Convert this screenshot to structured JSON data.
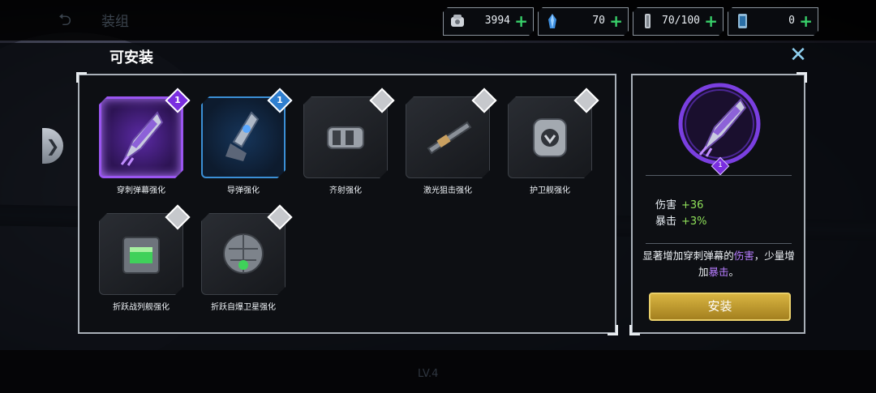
{
  "topbar": {
    "back_glyph": "⮌",
    "title": "装组",
    "resources": [
      {
        "icon": "silver-coin-icon",
        "value": "3994",
        "plus": "+"
      },
      {
        "icon": "blue-crystal-icon",
        "value": "70",
        "plus": "+"
      },
      {
        "icon": "metal-part-icon",
        "value": "70/100",
        "plus": "+"
      },
      {
        "icon": "energy-tank-icon",
        "value": "0",
        "plus": "+"
      }
    ]
  },
  "panel": {
    "title": "可安装",
    "close_glyph": "✕",
    "side_arrow_glyph": "❯"
  },
  "items": [
    {
      "name": "穿刺弹幕强化",
      "count": "1",
      "rarity": "purple",
      "selected": true
    },
    {
      "name": "导弹强化",
      "count": "1",
      "rarity": "blue",
      "selected": false
    },
    {
      "name": "齐射强化",
      "count": "",
      "rarity": "grey",
      "selected": false
    },
    {
      "name": "激光狙击强化",
      "count": "",
      "rarity": "grey",
      "selected": false
    },
    {
      "name": "护卫舰强化",
      "count": "",
      "rarity": "grey",
      "selected": false
    },
    {
      "name": "折跃战列舰强化",
      "count": "",
      "rarity": "grey",
      "selected": false
    },
    {
      "name": "折跃自爆卫星强化",
      "count": "",
      "rarity": "grey",
      "selected": false
    }
  ],
  "detail": {
    "badge": "1",
    "stats": [
      {
        "label": "伤害",
        "value": "+36"
      },
      {
        "label": "暴击",
        "value": "+3%"
      }
    ],
    "desc_part1": "显著增加穿刺弹幕的",
    "desc_hl1": "伤害",
    "desc_part2": "，少量增加",
    "desc_hl2": "暴击",
    "desc_part3": "。",
    "install_label": "安装"
  },
  "footer": {
    "level_text": "LV.4"
  },
  "colors": {
    "accent_purple": "#9a55f0",
    "accent_blue": "#3b8fd6",
    "plus_green": "#38d16a",
    "stat_green": "#8fe15a",
    "button_gold": "#c9a233"
  }
}
